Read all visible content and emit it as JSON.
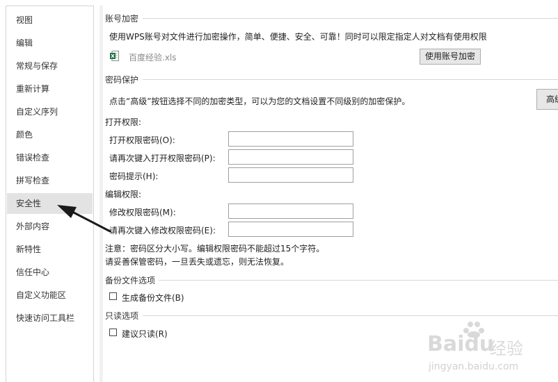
{
  "sidebar": {
    "items": [
      {
        "label": "视图"
      },
      {
        "label": "编辑"
      },
      {
        "label": "常规与保存"
      },
      {
        "label": "重新计算"
      },
      {
        "label": "自定义序列"
      },
      {
        "label": "颜色"
      },
      {
        "label": "错误检查"
      },
      {
        "label": "拼写检查"
      },
      {
        "label": "安全性"
      },
      {
        "label": "外部内容"
      },
      {
        "label": "新特性"
      },
      {
        "label": "信任中心"
      },
      {
        "label": "自定义功能区"
      },
      {
        "label": "快速访问工具栏"
      }
    ],
    "active": "安全性"
  },
  "account": {
    "title": "账号加密",
    "description": "使用WPS账号对文件进行加密操作，简单、便捷、安全、可靠！同时可以限定指定人对文档有使用权限",
    "filename": "百度经验.xls",
    "button": "使用账号加密"
  },
  "password": {
    "title": "密码保护",
    "description": "点击“高级”按钮选择不同的加密类型，可以为您的文档设置不同级别的加密保护。",
    "advanced_button": "高级",
    "open_heading": "打开权限:",
    "open_password_label": "打开权限密码(O):",
    "open_confirm_label": "请再次键入打开权限密码(P):",
    "hint_label": "密码提示(H):",
    "edit_heading": "编辑权限:",
    "edit_password_label": "修改权限密码(M):",
    "edit_confirm_label": "请再次键入修改权限密码(E):",
    "note_line1": "注意：密码区分大小写。编辑权限密码不能超过15个字符。",
    "note_line2": "请妥善保管密码，一旦丢失或遗忘，则无法恢复。"
  },
  "backup": {
    "title": "备份文件选项",
    "checkbox_label": "生成备份文件(B)"
  },
  "readonly": {
    "title": "只读选项",
    "checkbox_label": "建议只读(R)"
  },
  "watermark": {
    "brand": "Baidu",
    "brand_cn": "经验",
    "url": "jingyan.baidu.com"
  },
  "colors": {
    "active_bg": "#e3e3e3",
    "arrow": "#1a1a1a",
    "xls_icon": "#1e7145"
  }
}
